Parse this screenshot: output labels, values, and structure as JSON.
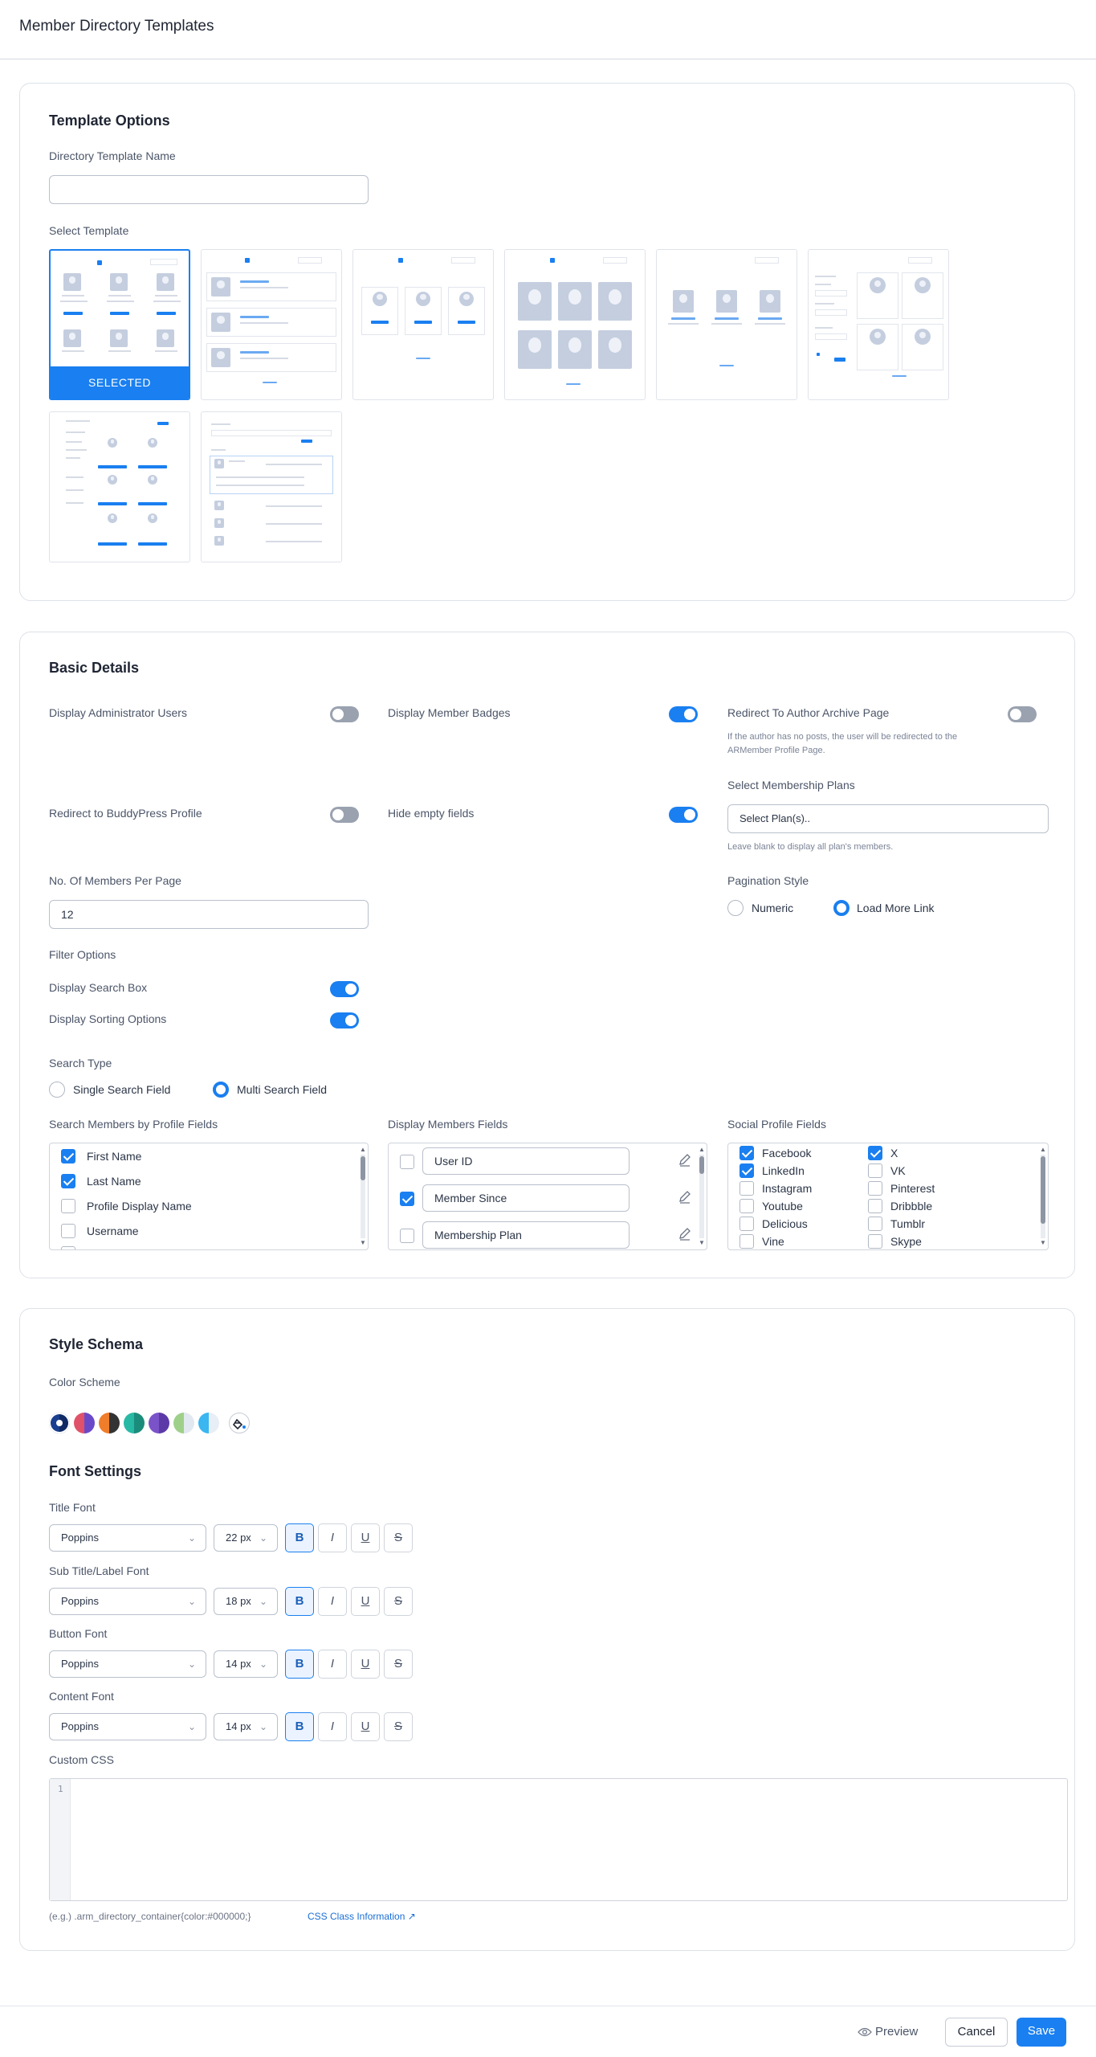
{
  "header": {
    "title": "Member Directory Templates"
  },
  "template_options": {
    "heading": "Template Options",
    "name_label": "Directory Template Name",
    "name_value": "",
    "select_label": "Select Template",
    "selected_label": "SELECTED"
  },
  "basic_details": {
    "heading": "Basic Details",
    "display_admin_users": "Display Administrator Users",
    "display_member_badges": "Display Member Badges",
    "redirect_author_archive": "Redirect To Author Archive Page",
    "redirect_author_note": "If the author has no posts, the user will be redirected to the ARMember Profile Page.",
    "redirect_buddypress": "Redirect to BuddyPress Profile",
    "hide_empty_fields": "Hide empty fields",
    "membership_plans_label": "Select Membership Plans",
    "membership_plans_placeholder": "Select Plan(s)..",
    "membership_plans_note": "Leave blank to display all plan's members.",
    "members_per_page_label": "No. Of Members Per Page",
    "members_per_page_value": "12",
    "pagination_label": "Pagination Style",
    "pagination_options": [
      "Numeric",
      "Load More Link"
    ],
    "pagination_selected": "Load More Link",
    "filter_options_label": "Filter Options",
    "display_search_box": "Display Search Box",
    "display_sorting_options": "Display Sorting Options",
    "search_type_label": "Search Type",
    "search_type_options": [
      "Single Search Field",
      "Multi Search Field"
    ],
    "search_type_selected": "Multi Search Field",
    "search_fields_label": "Search Members by Profile Fields",
    "search_fields": [
      {
        "label": "First Name",
        "checked": true
      },
      {
        "label": "Last Name",
        "checked": true
      },
      {
        "label": "Profile Display Name",
        "checked": false
      },
      {
        "label": "Username",
        "checked": false
      }
    ],
    "display_fields_label": "Display Members Fields",
    "display_fields": [
      {
        "label": "User ID",
        "checked": false
      },
      {
        "label": "Member Since",
        "checked": true
      },
      {
        "label": "Membership Plan",
        "checked": false
      }
    ],
    "social_fields_label": "Social Profile Fields",
    "social_fields_left": [
      {
        "label": "Facebook",
        "checked": true
      },
      {
        "label": "LinkedIn",
        "checked": true
      },
      {
        "label": "Instagram",
        "checked": false
      },
      {
        "label": "Youtube",
        "checked": false
      },
      {
        "label": "Delicious",
        "checked": false
      },
      {
        "label": "Vine",
        "checked": false
      }
    ],
    "social_fields_right": [
      {
        "label": "X",
        "checked": true
      },
      {
        "label": "VK",
        "checked": false
      },
      {
        "label": "Pinterest",
        "checked": false
      },
      {
        "label": "Dribbble",
        "checked": false
      },
      {
        "label": "Tumblr",
        "checked": false
      },
      {
        "label": "Skype",
        "checked": false
      }
    ]
  },
  "style_schema": {
    "heading": "Style Schema",
    "color_scheme_label": "Color Scheme",
    "color_schemes": [
      [
        "#1a3f8f",
        "#102a63"
      ],
      [
        "#e0526a",
        "#6a49c9"
      ],
      [
        "#f07d2a",
        "#333333"
      ],
      [
        "#28b9a5",
        "#1b8c7c"
      ],
      [
        "#7b53c9",
        "#5b3aa8"
      ],
      [
        "#9fd08a",
        "#e2e8ef"
      ],
      [
        "#3ab6f0",
        "#e8eef6"
      ]
    ],
    "font_settings_heading": "Font Settings",
    "fonts": [
      {
        "label": "Title Font",
        "family": "Poppins",
        "size": "22 px"
      },
      {
        "label": "Sub Title/Label Font",
        "family": "Poppins",
        "size": "18 px"
      },
      {
        "label": "Button Font",
        "family": "Poppins",
        "size": "14 px"
      },
      {
        "label": "Content Font",
        "family": "Poppins",
        "size": "14 px"
      }
    ],
    "format_buttons": [
      "B",
      "I",
      "U",
      "S"
    ],
    "custom_css_label": "Custom CSS",
    "css_line_number": "1",
    "css_example": "(e.g.)  .arm_directory_container{color:#000000;}",
    "css_info_link": "CSS Class Information ↗"
  },
  "footer": {
    "preview": "Preview",
    "cancel": "Cancel",
    "save": "Save"
  }
}
